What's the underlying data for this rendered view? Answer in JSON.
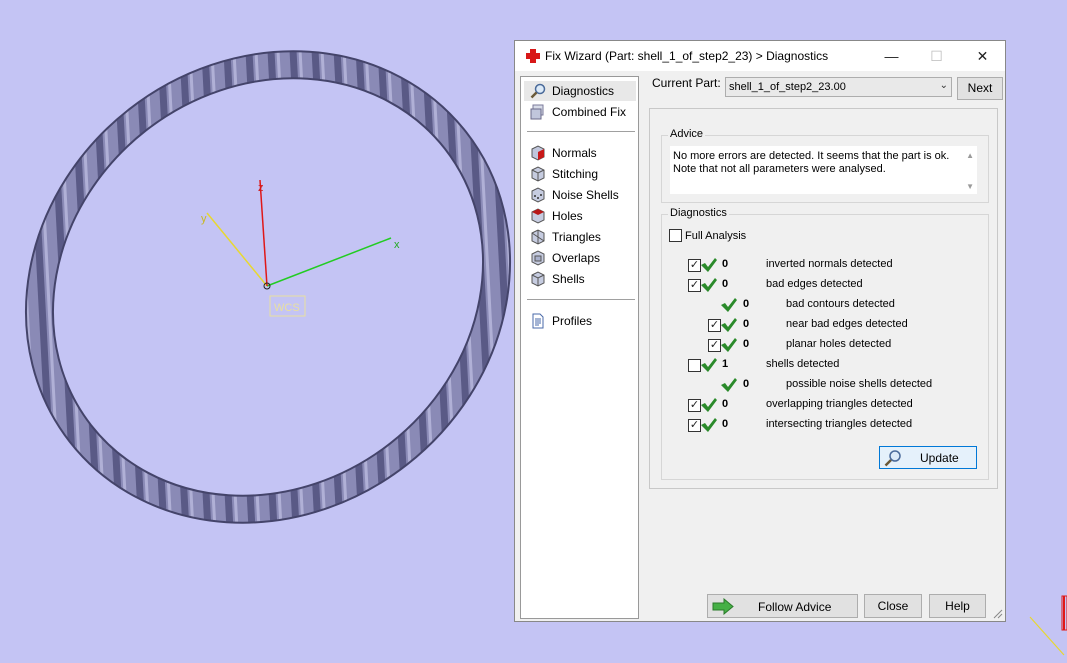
{
  "colors": {
    "viewport_bg": "#c4c4f4",
    "torus": "#7c7ca8",
    "axis_x": "#22cc22",
    "axis_y": "#e8d830",
    "axis_z": "#e01818",
    "check_green": "#2a8a2a"
  },
  "viewport": {
    "axis_x_label": "x",
    "axis_y_label": "y",
    "axis_z_label": "z",
    "wcs_label": "WCS"
  },
  "dialog": {
    "title": "Fix Wizard (Part: shell_1_of_step2_23) > Diagnostics",
    "title_icon": "red-cross-icon",
    "window_buttons": {
      "minimize": "—",
      "maximize": "☐",
      "close": "✕"
    },
    "nav": {
      "top_items": [
        {
          "label": "Diagnostics",
          "icon": "magnifier-icon",
          "selected": true
        },
        {
          "label": "Combined Fix",
          "icon": "cubes-icon"
        }
      ],
      "tool_items": [
        {
          "label": "Normals",
          "icon": "cube-red-icon"
        },
        {
          "label": "Stitching",
          "icon": "stitch-cube-icon"
        },
        {
          "label": "Noise Shells",
          "icon": "noise-cube-icon"
        },
        {
          "label": "Holes",
          "icon": "hole-cube-icon"
        },
        {
          "label": "Triangles",
          "icon": "triangle-cube-icon"
        },
        {
          "label": "Overlaps",
          "icon": "overlap-cube-icon"
        },
        {
          "label": "Shells",
          "icon": "shell-cube-icon"
        }
      ],
      "bottom_items": [
        {
          "label": "Profiles",
          "icon": "document-icon"
        }
      ]
    },
    "current_part": {
      "label": "Current Part:",
      "value": "shell_1_of_step2_23.00",
      "next_label": "Next"
    },
    "advice": {
      "title": "Advice",
      "text": "No more errors are detected. It seems that the part is ok. Note that not all parameters were analysed."
    },
    "diagnostics": {
      "title": "Diagnostics",
      "full_analysis": {
        "label": "Full Analysis",
        "checked": false
      },
      "rows": [
        {
          "checkbox": true,
          "checked": true,
          "count": "0",
          "text": "inverted normals detected",
          "indent": 0
        },
        {
          "checkbox": true,
          "checked": true,
          "count": "0",
          "text": "bad edges detected",
          "indent": 0
        },
        {
          "checkbox": false,
          "checked": false,
          "count": "0",
          "text": "bad contours detected",
          "indent": 1
        },
        {
          "checkbox": true,
          "checked": true,
          "count": "0",
          "text": "near bad edges detected",
          "indent": 1
        },
        {
          "checkbox": true,
          "checked": true,
          "count": "0",
          "text": "planar holes detected",
          "indent": 1
        },
        {
          "checkbox": true,
          "checked": false,
          "count": "1",
          "text": "shells detected",
          "indent": 0
        },
        {
          "checkbox": false,
          "checked": false,
          "count": "0",
          "text": "possible noise shells detected",
          "indent": 1
        },
        {
          "checkbox": true,
          "checked": true,
          "count": "0",
          "text": "overlapping triangles detected",
          "indent": 0
        },
        {
          "checkbox": true,
          "checked": true,
          "count": "0",
          "text": "intersecting triangles detected",
          "indent": 0
        }
      ],
      "update_label": "Update"
    },
    "buttons": {
      "follow_advice": "Follow Advice",
      "close": "Close",
      "help": "Help"
    }
  }
}
